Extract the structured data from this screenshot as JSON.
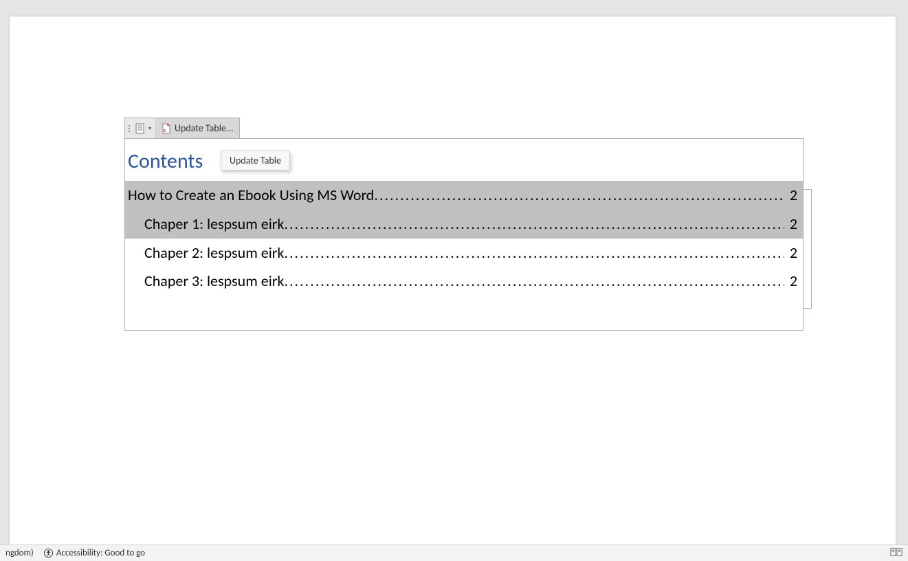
{
  "toolbar": {
    "update_label": "Update Table..."
  },
  "tooltip": {
    "text": "Update Table"
  },
  "toc": {
    "title": "Contents",
    "entries": [
      {
        "label": "How to Create an Ebook Using MS Word",
        "page": "2",
        "indent": false,
        "selected": true
      },
      {
        "label": "Chaper 1: lespsum eirk",
        "page": "2",
        "indent": true,
        "selected": true
      },
      {
        "label": "Chaper 2: lespsum eirk",
        "page": "2",
        "indent": true,
        "selected": false
      },
      {
        "label": "Chaper 3: lespsum eirk",
        "page": "2",
        "indent": true,
        "selected": false
      }
    ]
  },
  "status": {
    "language_fragment": "ngdom)",
    "accessibility": "Accessibility: Good to go"
  }
}
